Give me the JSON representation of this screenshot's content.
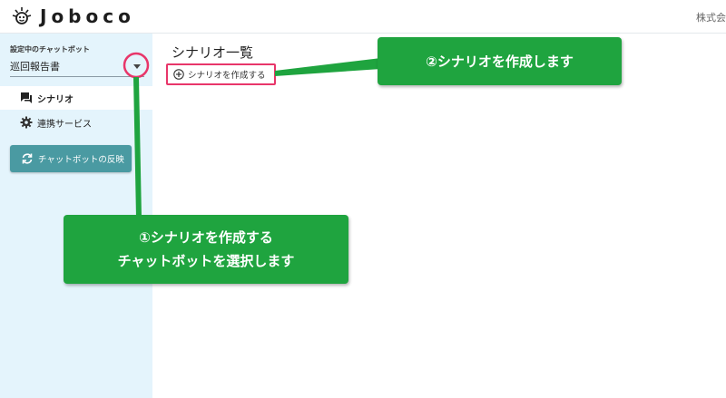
{
  "header": {
    "logo_text": "Joboco",
    "company_text": "株式会"
  },
  "sidebar": {
    "bot_label": "設定中のチャットボット",
    "bot_value": "巡回報告書",
    "items": [
      {
        "label": "シナリオ",
        "icon": "chat-icon",
        "active": true
      },
      {
        "label": "連携サービス",
        "icon": "gear-icon",
        "active": false
      }
    ],
    "reflect_button_label": "チャットボットの反映"
  },
  "main": {
    "page_title": "シナリオ一覧",
    "create_link_label": "シナリオを作成する"
  },
  "annotations": {
    "callout_2": "②シナリオを作成します",
    "callout_1_line1": "①シナリオを作成する",
    "callout_1_line2": "チャットボットを選択します"
  },
  "colors": {
    "sidebar_bg": "#e4f4fc",
    "button_teal": "#4a9aa2",
    "callout_green": "#1fa43f",
    "highlight_pink": "#e8366a"
  }
}
